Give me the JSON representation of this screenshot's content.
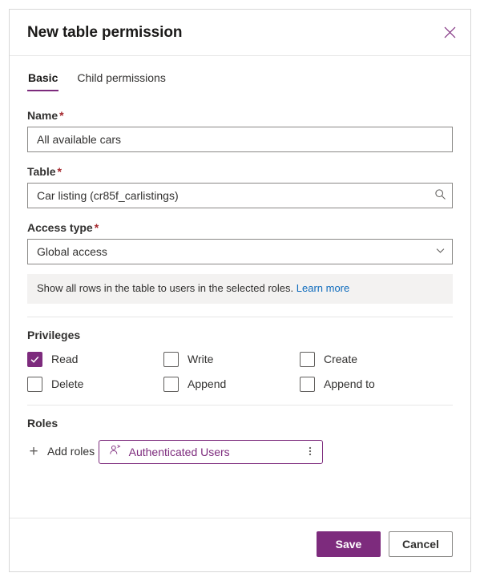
{
  "dialog": {
    "title": "New table permission",
    "close_icon": "close-icon"
  },
  "tabs": [
    {
      "label": "Basic",
      "active": true
    },
    {
      "label": "Child permissions",
      "active": false
    }
  ],
  "fields": {
    "name": {
      "label": "Name",
      "required_marker": "*",
      "value": "All available cars",
      "placeholder": ""
    },
    "table": {
      "label": "Table",
      "required_marker": "*",
      "value": "Car listing (cr85f_carlistings)",
      "placeholder": "",
      "icon": "search-icon"
    },
    "access_type": {
      "label": "Access type",
      "required_marker": "*",
      "value": "Global access",
      "icon": "chevron-down-icon",
      "options": [
        "Global access"
      ]
    }
  },
  "hint": {
    "text": "Show all rows in the table to users in the selected roles.",
    "link_text": "Learn more"
  },
  "privileges": {
    "title": "Privileges",
    "items": [
      {
        "label": "Read",
        "checked": true
      },
      {
        "label": "Write",
        "checked": false
      },
      {
        "label": "Create",
        "checked": false
      },
      {
        "label": "Delete",
        "checked": false
      },
      {
        "label": "Append",
        "checked": false
      },
      {
        "label": "Append to",
        "checked": false
      }
    ]
  },
  "roles": {
    "title": "Roles",
    "add_label": "Add roles",
    "add_icon": "plus-icon",
    "chips": [
      {
        "name": "Authenticated Users",
        "icon": "person-icon",
        "more_icon": "more-vertical-icon"
      }
    ]
  },
  "footer": {
    "save_label": "Save",
    "cancel_label": "Cancel"
  },
  "colors": {
    "accent": "#7d2b7d",
    "link": "#0f6cbd",
    "required": "#a4262c",
    "hint_bg": "#f3f2f1"
  }
}
